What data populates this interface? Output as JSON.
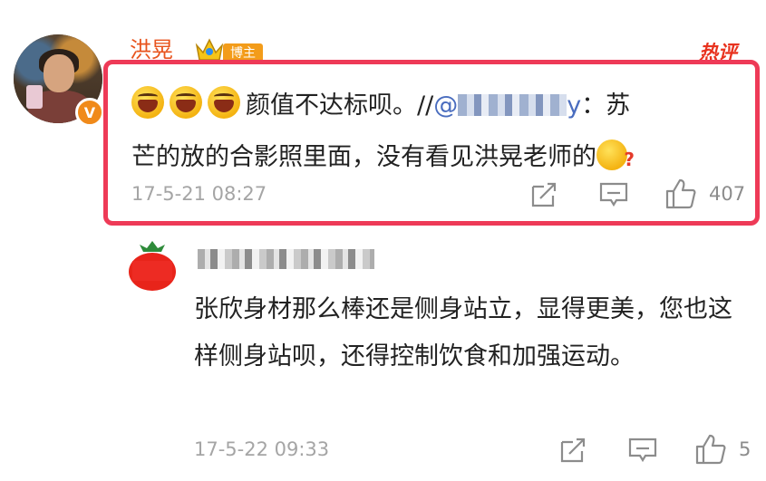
{
  "comment": {
    "author": "洪晃",
    "badge": "博主",
    "hot_label": "热评",
    "text_main": "颜值不达标呗。//",
    "mention_prefix": "@",
    "mention_suffix": "y",
    "text_after_mention": "：苏",
    "text_line2": "芒的放的合影照里面，没有看见洪晃老师的",
    "timestamp": "17-5-21 08:27",
    "like_count": "407"
  },
  "reply": {
    "text": "张欣身材那么棒还是侧身站立，显得更美，您也这样侧身站呗，还得控制饮食和加强运动。",
    "timestamp": "17-5-22 09:33",
    "like_count": "5"
  },
  "colors": {
    "highlight_border": "#ee3a57",
    "author_name": "#e8541e",
    "hot_label": "#e8321e",
    "mention": "#4a6dbf",
    "timestamp": "#a5a5a5"
  },
  "icons": [
    "verified-v-icon",
    "crown-icon",
    "laugh-emoji",
    "thinking-emoji",
    "share-icon",
    "comment-icon",
    "like-icon",
    "tomato-avatar"
  ]
}
